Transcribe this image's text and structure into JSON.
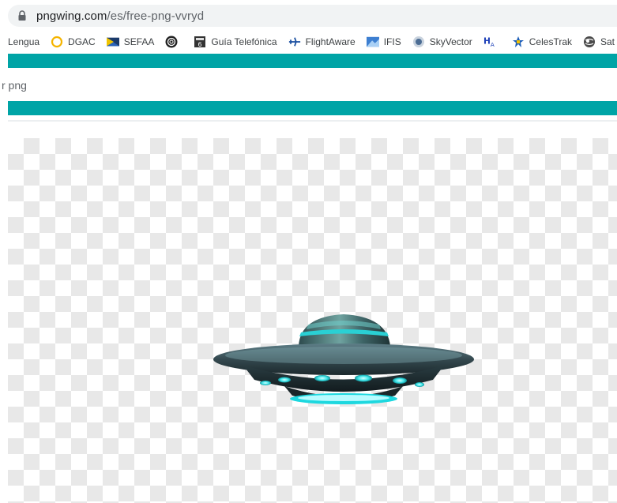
{
  "browser": {
    "url_host": "pngwing.com",
    "url_path": "/es/free-png-vvryd"
  },
  "bookmarks": [
    {
      "label": "Lengua",
      "icon": "bookmark-icon"
    },
    {
      "label": "DGAC",
      "icon": "ring-icon"
    },
    {
      "label": "SEFAA",
      "icon": "flag-icon"
    },
    {
      "label": "",
      "icon": "spiral-icon"
    },
    {
      "label": "Guía Telefónica",
      "icon": "phonebook-icon"
    },
    {
      "label": "FlightAware",
      "icon": "airplane-icon"
    },
    {
      "label": "IFIS",
      "icon": "ifis-icon"
    },
    {
      "label": "SkyVector",
      "icon": "skyvector-icon"
    },
    {
      "label": "",
      "icon": "ha-icon"
    },
    {
      "label": "CelesTrak",
      "icon": "satellite-icon"
    },
    {
      "label": "Sat Flare",
      "icon": "globe-icon"
    }
  ],
  "page": {
    "search_query": "r png"
  },
  "colors": {
    "accent": "#00a4a6",
    "checker": "#e8e8e8"
  },
  "image": {
    "subject": "ufo-image"
  }
}
